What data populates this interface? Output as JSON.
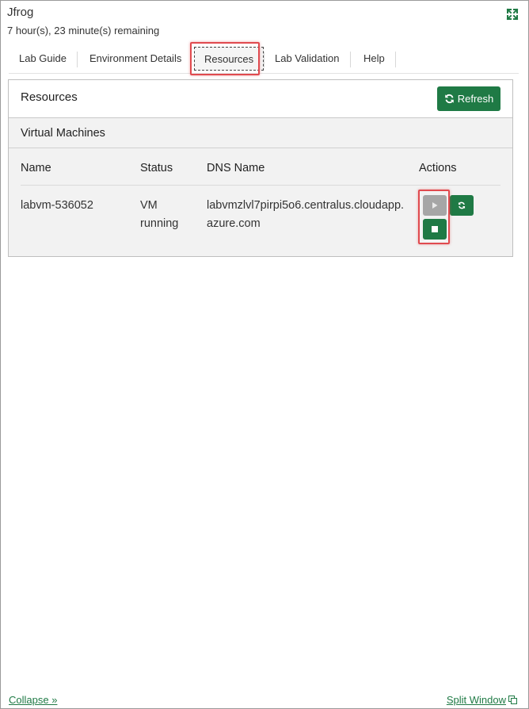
{
  "header": {
    "title": "Jfrog",
    "remaining": "7 hour(s), 23 minute(s) remaining"
  },
  "tabs": [
    {
      "label": "Lab Guide"
    },
    {
      "label": "Environment Details"
    },
    {
      "label": "Resources",
      "active": true
    },
    {
      "label": "Lab Validation"
    },
    {
      "label": "Help"
    }
  ],
  "resources": {
    "title": "Resources",
    "refresh_label": "Refresh",
    "section_title": "Virtual Machines",
    "columns": [
      "Name",
      "Status",
      "DNS Name",
      "Actions"
    ],
    "rows": [
      {
        "name": "labvm-536052",
        "status_line1": "VM",
        "status_line2": "running",
        "dns_line1": "labvmzlvl7pirpi5o6.centralus.cloudapp.",
        "dns_line2": "azure.com"
      }
    ]
  },
  "footer": {
    "collapse": "Collapse »",
    "split_window": "Split Window"
  },
  "colors": {
    "accent": "#1f7a45",
    "highlight": "#e04a4f",
    "disabled_button": "#a6a6a6"
  },
  "icons": [
    "expand-icon",
    "refresh-icon",
    "play-icon",
    "restart-icon",
    "stop-icon",
    "split-window-icon"
  ]
}
